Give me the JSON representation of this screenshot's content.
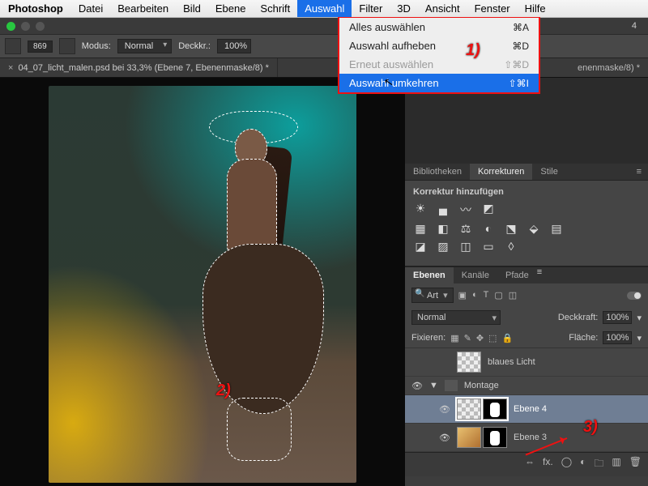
{
  "menubar": {
    "app": "Photoshop",
    "items": [
      "Datei",
      "Bearbeiten",
      "Bild",
      "Ebene",
      "Schrift",
      "Auswahl",
      "Filter",
      "3D",
      "Ansicht",
      "Fenster",
      "Hilfe"
    ],
    "active_index": 5
  },
  "chrome": {
    "right_tab_suffix": "4"
  },
  "toolbar": {
    "brush_size": "869",
    "mode_label": "Modus:",
    "mode_value": "Normal",
    "opacity_label": "Deckkr.:",
    "opacity_value": "100%"
  },
  "doc_tabs": {
    "main": "04_07_licht_malen.psd bei 33,3% (Ebene 7, Ebenenmaske/8) *",
    "secondary": "enenmaske/8) *"
  },
  "menu": {
    "items": [
      {
        "label": "Alles auswählen",
        "shortcut": "⌘A",
        "state": "normal"
      },
      {
        "label": "Auswahl aufheben",
        "shortcut": "⌘D",
        "state": "normal"
      },
      {
        "label": "Erneut auswählen",
        "shortcut": "⇧⌘D",
        "state": "disabled"
      },
      {
        "label": "Auswahl umkehren",
        "shortcut": "⇧⌘I",
        "state": "selected"
      }
    ]
  },
  "annotations": {
    "a1": "1)",
    "a2": "2)",
    "a3": "3)"
  },
  "panels": {
    "lib_tabs": [
      "Bibliotheken",
      "Korrekturen",
      "Stile"
    ],
    "lib_active": 1,
    "adjust_title": "Korrektur hinzufügen",
    "layers_tabs": [
      "Ebenen",
      "Kanäle",
      "Pfade"
    ],
    "layers_active": 0,
    "kind_filter": "Art",
    "blend_mode": "Normal",
    "opacity_label": "Deckkraft:",
    "opacity_value": "100%",
    "lock_label": "Fixieren:",
    "fill_label": "Fläche:",
    "fill_value": "100%",
    "layers": [
      {
        "eye": false,
        "type": "layer",
        "name": "blaues Licht",
        "indent": true
      },
      {
        "eye": true,
        "type": "group",
        "name": "Montage"
      },
      {
        "eye": true,
        "type": "masked",
        "name": "Ebene 4",
        "indent": true,
        "selected": true
      },
      {
        "eye": true,
        "type": "masked",
        "name": "Ebene 3",
        "indent": true
      }
    ]
  }
}
